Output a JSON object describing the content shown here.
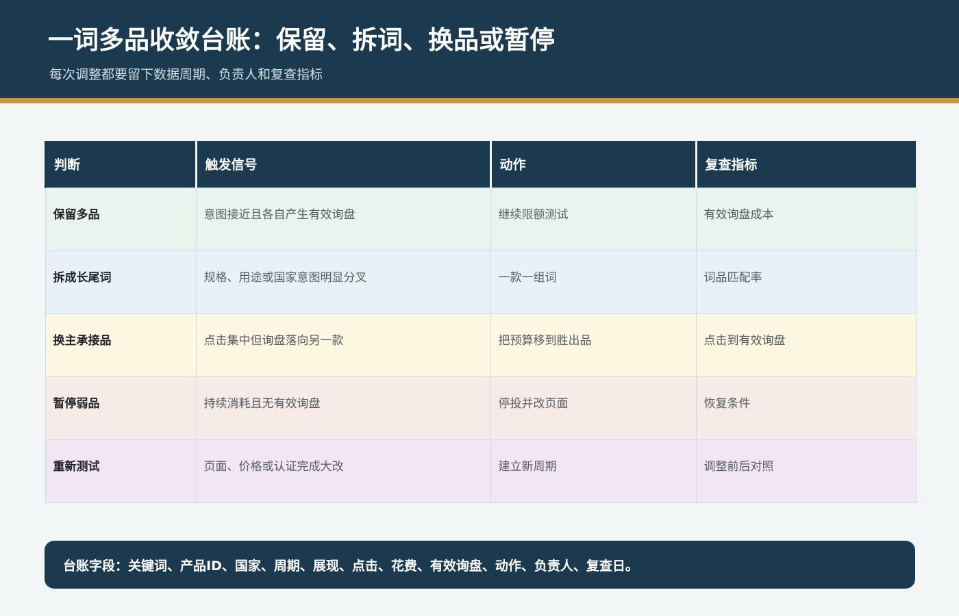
{
  "header": {
    "title": "一词多品收敛台账：保留、拆词、换品或暂停",
    "subtitle": "每次调整都要留下数据周期、负责人和复查指标"
  },
  "table": {
    "columns": [
      "判断",
      "触发信号",
      "动作",
      "复查指标"
    ],
    "rows": [
      [
        "保留多品",
        "意图接近且各自产生有效询盘",
        "继续限额测试",
        "有效询盘成本"
      ],
      [
        "拆成长尾词",
        "规格、用途或国家意图明显分叉",
        "一款一组词",
        "词品匹配率"
      ],
      [
        "换主承接品",
        "点击集中但询盘落向另一款",
        "把预算移到胜出品",
        "点击到有效询盘"
      ],
      [
        "暂停弱品",
        "持续消耗且无有效询盘",
        "停投并改页面",
        "恢复条件"
      ],
      [
        "重新测试",
        "页面、价格或认证完成大改",
        "建立新周期",
        "调整前后对照"
      ]
    ]
  },
  "footer": {
    "note": "台账字段：关键词、产品ID、国家、周期、展现、点击、花费、有效询盘、动作、负责人、复查日。"
  },
  "colors": {
    "header_bg": "#1b3a50",
    "accent_stripe": "#c8963c",
    "row_backgrounds": [
      "#eaf4ee",
      "#e8f0f8",
      "#fdf6e0",
      "#f6ebe6",
      "#f2e6f4"
    ]
  }
}
